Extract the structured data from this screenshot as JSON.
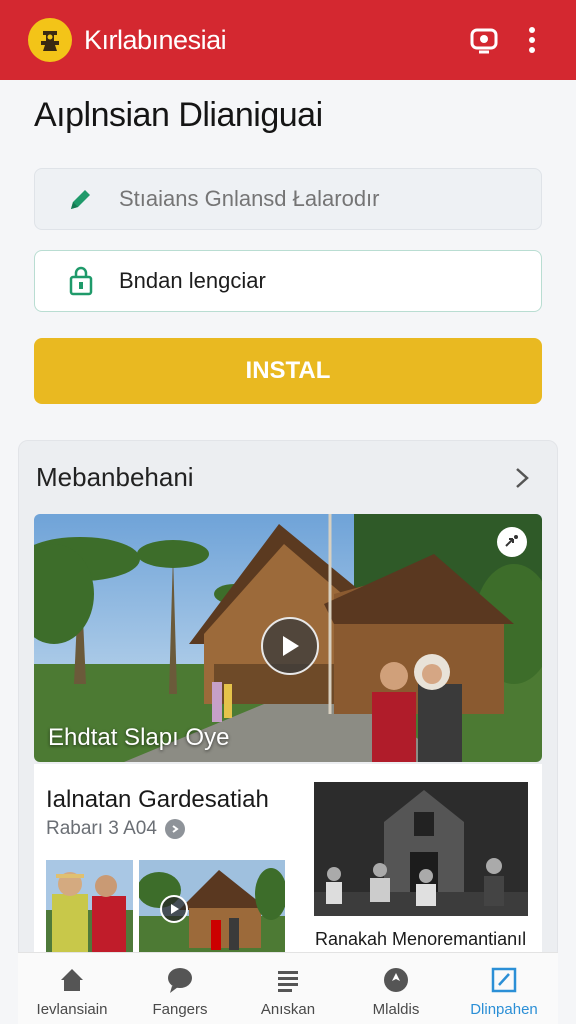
{
  "appbar": {
    "title": "Kırlabınesiai",
    "background": "#d42830",
    "logo_icon": "emblem-icon",
    "actions": [
      "cast-icon",
      "more-vert-icon"
    ]
  },
  "page": {
    "title": "Aıplnsian Dlianiguai"
  },
  "form": {
    "field1_placeholder": "Stıaians Gnlansd Łalarodır",
    "field1_icon": "pencil-icon",
    "field2_value": "Bndan lengciar",
    "field2_icon": "lock-icon",
    "install_label": "INSTAL",
    "install_color": "#e9b921"
  },
  "section": {
    "title": "Mebanbehani",
    "arrow_icon": "chevron-right-icon",
    "video": {
      "caption": "Ehdtat Slapı Oye",
      "play_icon": "play-icon",
      "share_icon": "share-icon"
    },
    "article": {
      "title": "Ialnatan Gardesatiah",
      "meta": "Rabarı 3 A04",
      "meta_icon": "info-icon"
    },
    "side_article": {
      "caption": "Ranakah Menoremantianıl"
    }
  },
  "bottom_nav": {
    "items": [
      {
        "label": "Ievlansiain",
        "icon": "home-icon"
      },
      {
        "label": "Fangers",
        "icon": "chat-icon"
      },
      {
        "label": "Anıskan",
        "icon": "list-icon"
      },
      {
        "label": "Mlaldis",
        "icon": "location-icon"
      },
      {
        "label": "Dlinpahen",
        "icon": "edit-icon"
      }
    ],
    "active_color": "#2b8fd6"
  }
}
